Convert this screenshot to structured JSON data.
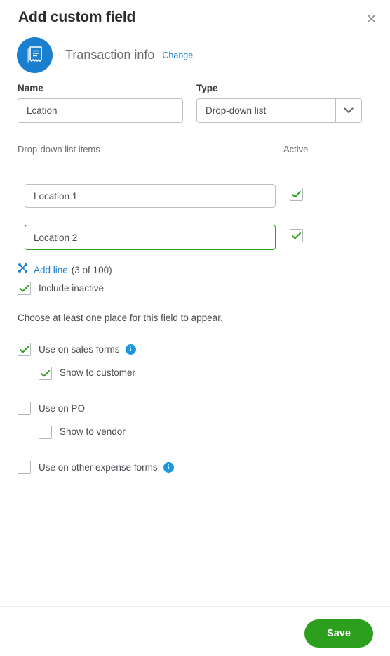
{
  "dialog": {
    "title": "Add custom field",
    "close_icon": "close-icon"
  },
  "entity": {
    "icon": "receipt-icon",
    "name": "Transaction info",
    "change_label": "Change"
  },
  "form": {
    "name_label": "Name",
    "name_value": "Lcation",
    "name_placeholder": "",
    "type_label": "Type",
    "type_value": "Drop-down list",
    "type_arrow_icon": "chevron-down-icon"
  },
  "list_section": {
    "items_label": "Drop-down list items",
    "active_label": "Active",
    "items": [
      {
        "value": "Location 1",
        "focused": false,
        "active": true
      },
      {
        "value": "Location 2",
        "focused": true,
        "active": true
      }
    ],
    "add_line_icon": "add-line-icon",
    "add_line_label": "Add line",
    "add_line_count": "(3 of 100)",
    "include_inactive_label": "Include inactive",
    "include_inactive_checked": true
  },
  "placement": {
    "helper_text": "Choose at least one place for this field to appear.",
    "options": [
      {
        "label": "Use on sales forms",
        "checked": true,
        "info_icon": "info-icon",
        "has_info": true,
        "child": {
          "label": "Show to customer",
          "checked": true
        }
      },
      {
        "label": "Use on PO",
        "checked": false,
        "has_info": false,
        "child": {
          "label": "Show to vendor",
          "checked": false
        }
      },
      {
        "label": "Use on other expense forms",
        "checked": false,
        "info_icon": "info-icon",
        "has_info": true,
        "child": null
      }
    ]
  },
  "footer": {
    "save_label": "Save"
  },
  "colors": {
    "brand_green": "#2ca01c",
    "brand_blue": "#1b7fd0",
    "info_blue": "#1b96e0",
    "text": "#393a3d"
  }
}
